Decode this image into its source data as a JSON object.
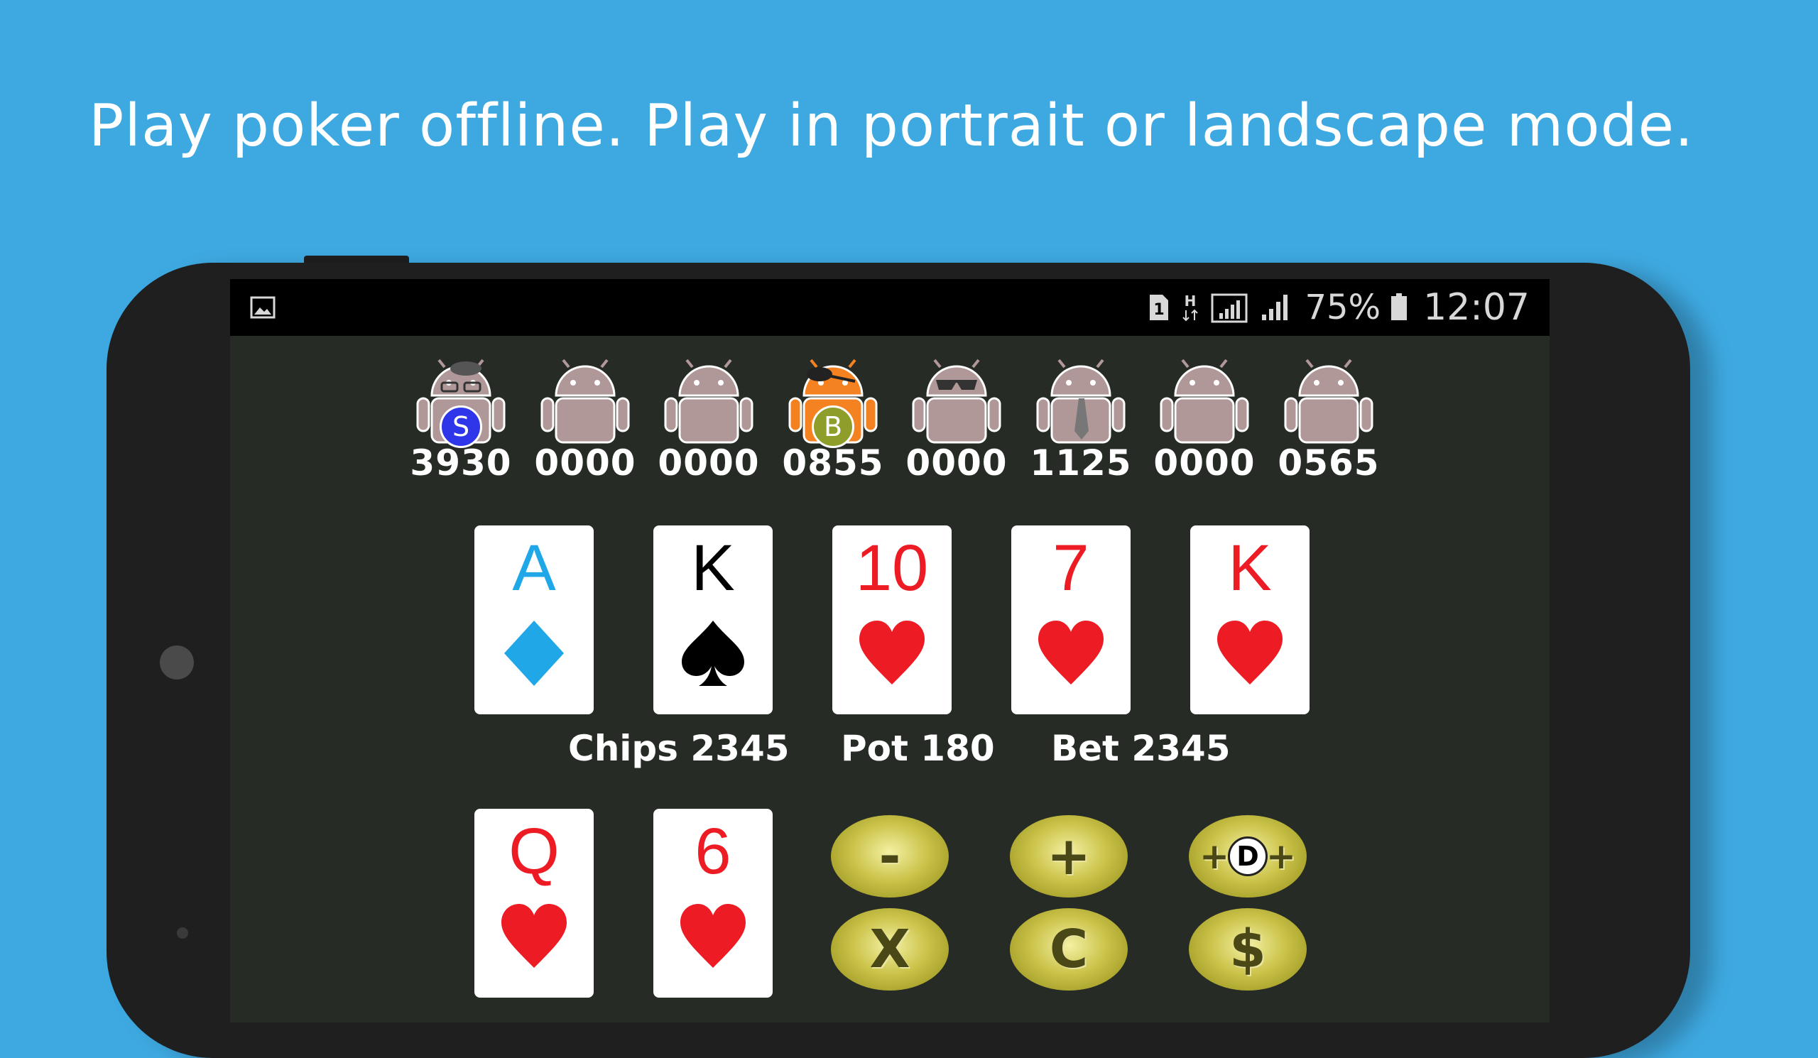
{
  "headline": "Play poker offline. Play in portrait or landscape mode.",
  "status_bar": {
    "sim": "1",
    "network": "H",
    "battery_percent": "75%",
    "time": "12:07",
    "icons": [
      "gallery-icon",
      "sim-icon",
      "h-network-icon",
      "signal-icon",
      "signal-icon",
      "battery-icon"
    ]
  },
  "players": [
    {
      "chips": "3930",
      "badge": "S",
      "color": "#b09898",
      "accessory": "glasses-hat"
    },
    {
      "chips": "0000",
      "badge": "",
      "color": "#b09898",
      "accessory": "none"
    },
    {
      "chips": "0000",
      "badge": "",
      "color": "#b09898",
      "accessory": "none"
    },
    {
      "chips": "0855",
      "badge": "B",
      "color": "#f58220",
      "accessory": "eyepatch"
    },
    {
      "chips": "0000",
      "badge": "",
      "color": "#b09898",
      "accessory": "sunglasses"
    },
    {
      "chips": "1125",
      "badge": "",
      "color": "#b09898",
      "accessory": "tie"
    },
    {
      "chips": "0000",
      "badge": "",
      "color": "#b09898",
      "accessory": "none"
    },
    {
      "chips": "0565",
      "badge": "",
      "color": "#b09898",
      "accessory": "none"
    }
  ],
  "community_cards": [
    {
      "rank": "A",
      "suit": "diamond",
      "color": "#20a7e8"
    },
    {
      "rank": "K",
      "suit": "spade",
      "color": "#000000"
    },
    {
      "rank": "10",
      "suit": "heart",
      "color": "#ed1c24"
    },
    {
      "rank": "7",
      "suit": "heart",
      "color": "#ed1c24"
    },
    {
      "rank": "K",
      "suit": "heart",
      "color": "#ed1c24"
    }
  ],
  "info": {
    "chips": "Chips 2345",
    "pot": "Pot 180",
    "bet": "Bet 2345"
  },
  "hand_cards": [
    {
      "rank": "Q",
      "suit": "heart",
      "color": "#ed1c24"
    },
    {
      "rank": "6",
      "suit": "heart",
      "color": "#ed1c24"
    }
  ],
  "buttons": {
    "minus": "-",
    "plus": "+",
    "double_plus_left": "+",
    "double_d": "D",
    "double_plus_right": "+",
    "fold": "X",
    "call": "C",
    "bet": "$"
  }
}
